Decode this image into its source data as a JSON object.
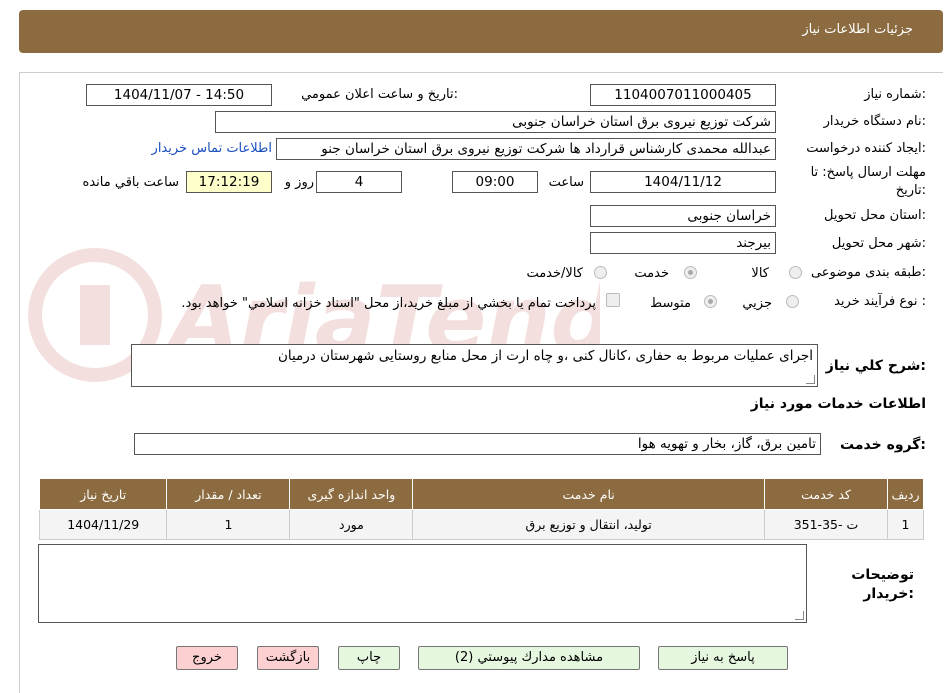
{
  "header": {
    "title": "جزئيات اطلاعات نياز"
  },
  "fields": {
    "need_number_label": "شماره نياز:",
    "need_number": "1104007011000405",
    "announce_label": "تاريخ و ساعت اعلان عمومي:",
    "announce_value": "1404/11/07 - 14:50",
    "buyer_org_label": "نام دستگاه خريدار:",
    "buyer_org": "شركت توزيع نيروی برق استان خراسان جنوبی",
    "creator_label": "ايجاد كننده درخواست:",
    "creator": "عبدالله محمدی کارشناس قرارداد ها شرکت توزیع نیروی برق استان خراسان جنو",
    "contact_link": "اطلاعات تماس خريدار",
    "deadline_label_1": "مهلت ارسال پاسخ: تا",
    "deadline_label_2": "تاريخ:",
    "deadline_date": "1404/11/12",
    "time_label": "ساعت",
    "deadline_time": "09:00",
    "days": "4",
    "days_label": "روز و",
    "remaining_time": "17:12:19",
    "remaining_label": "ساعت باقي مانده",
    "province_label": "استان محل تحويل:",
    "province": "خراسان جنوبی",
    "city_label": "شهر محل تحويل:",
    "city": "بیرجند",
    "category_label": "طبقه بندی موضوعی:",
    "category_options": [
      "كالا",
      "خدمت",
      "كالا/خدمت"
    ],
    "category_selected": "خدمت",
    "process_label": "نوع فرآيند خريد :",
    "process_options": [
      "جزيي",
      "متوسط"
    ],
    "process_selected": "متوسط",
    "payment_note": "پرداخت تمام يا بخشي از مبلغ خريد،از محل \"اسناد خزانه اسلامي\" خواهد بود."
  },
  "description": {
    "label": "شرح كلي نياز:",
    "value": "اجرای عملیات مربوط به حفاری ،کانال کنی ،و چاه ارت از محل منابع روستایی شهرستان درمیان"
  },
  "services": {
    "section_title": "اطلاعات خدمات مورد نياز",
    "group_label": "گروه خدمت:",
    "group_value": "تامين برق، گاز، بخار و تهويه هوا",
    "columns": [
      "رديف",
      "كد خدمت",
      "نام خدمت",
      "واحد اندازه گيری",
      "تعداد / مقدار",
      "تاريخ نياز"
    ],
    "rows": [
      {
        "index": "1",
        "code": "ت -35-351",
        "name": "توليد، انتقال و توزيع برق",
        "unit": "مورد",
        "qty": "1",
        "date": "1404/11/29"
      }
    ]
  },
  "buyer_notes": {
    "label_1": "توضيحات",
    "label_2": "خريدار:"
  },
  "buttons": {
    "reply": "پاسخ به نياز",
    "attachments": "مشاهده مدارك پيوستي (2)",
    "print": "چاپ",
    "back": "بازگشت",
    "exit": "خروج"
  },
  "colors": {
    "header_bg": "#8b6b3f",
    "button_green": "#e6f7e0",
    "button_pink": "#fcd0d0",
    "link": "#1a4fbf",
    "highlight": "#ffffcc"
  }
}
